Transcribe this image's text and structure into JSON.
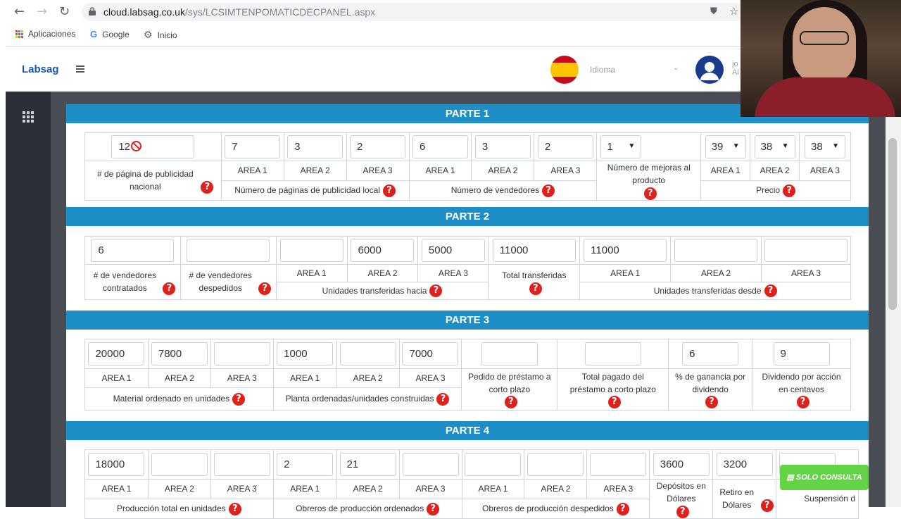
{
  "browser": {
    "url_domain": "cloud.labsag.co.uk",
    "url_path": "/sys/LCSIMTENPOMATICDECPANEL.aspx",
    "bookmarks": [
      {
        "label": "Aplicaciones",
        "icon": "apps-grid-icon"
      },
      {
        "label": "Google",
        "icon": "google-icon"
      },
      {
        "label": "Inicio",
        "icon": "gear-icon"
      }
    ]
  },
  "header": {
    "logo": "Labsag",
    "language_label": "Idioma",
    "user_initials": "jo",
    "user_sub": "Al"
  },
  "parts": {
    "p1": {
      "title": "PARTE 1",
      "pagina_nacional": {
        "value": "12",
        "label": "# de página de publicidad nacional"
      },
      "pub_local": {
        "values": [
          "7",
          "3",
          "2"
        ],
        "label": "Número de páginas de publicidad local"
      },
      "vendedores": {
        "values": [
          "6",
          "3",
          "2"
        ],
        "label": "Número de vendedores"
      },
      "mejoras": {
        "value": "1",
        "label": "Número de mejoras al producto"
      },
      "precio": {
        "values": [
          "39",
          "38",
          "38"
        ],
        "label": "Precio"
      }
    },
    "p2": {
      "title": "PARTE 2",
      "contratados": {
        "value": "6",
        "label": "# de vendedores contratados"
      },
      "despedidos": {
        "value": "",
        "label": "# de vendedores despedidos"
      },
      "transf_hacia": {
        "values": [
          "",
          "6000",
          "5000"
        ],
        "label": "Unidades transferidas hacia"
      },
      "total_transf": {
        "value": "11000",
        "label": "Total transferidas"
      },
      "transf_desde": {
        "values": [
          "11000",
          "",
          ""
        ],
        "label": "Unidades transferidas desde"
      }
    },
    "p3": {
      "title": "PARTE 3",
      "material": {
        "values": [
          "20000",
          "7800",
          ""
        ],
        "label": "Material ordenado en unidades"
      },
      "planta": {
        "values": [
          "1000",
          "",
          "7000"
        ],
        "label": "Planta ordenadas/unidades construidas"
      },
      "prestamo": {
        "value": "",
        "label": "Pedido de préstamo a corto plazo"
      },
      "total_pagado": {
        "value": "",
        "label": "Total pagado del préstamo a corto plazo"
      },
      "ganancia": {
        "value": "6",
        "label": "% de ganancia por dividendo"
      },
      "dividendo": {
        "value": "9",
        "label": "Dividendo por acción en centavos"
      }
    },
    "p4": {
      "title": "PARTE 4",
      "produccion": {
        "values": [
          "18000",
          "",
          ""
        ],
        "label": "Producción total en unidades"
      },
      "obreros_ord": {
        "values": [
          "2",
          "21",
          ""
        ],
        "label": "Obreros de producción ordenados"
      },
      "obreros_desp": {
        "values": [
          "",
          "",
          ""
        ],
        "label": "Obreros de producción despedidos"
      },
      "depositos": {
        "value": "3600",
        "label": "Depósitos en Dólares"
      },
      "retiro": {
        "value": "3200",
        "label": "Retiro en Dólares"
      },
      "suspension": {
        "value": "",
        "label": "Suspensión d"
      }
    }
  },
  "area_labels": [
    "AREA 1",
    "AREA 2",
    "AREA 3"
  ],
  "help_symbol": "?",
  "solo_consulta": "SOLO CONSULTA",
  "colors": {
    "part_header": "#1e8fc6",
    "help": "#e0201b",
    "logo": "#1a56b0",
    "solo": "#63d443"
  }
}
